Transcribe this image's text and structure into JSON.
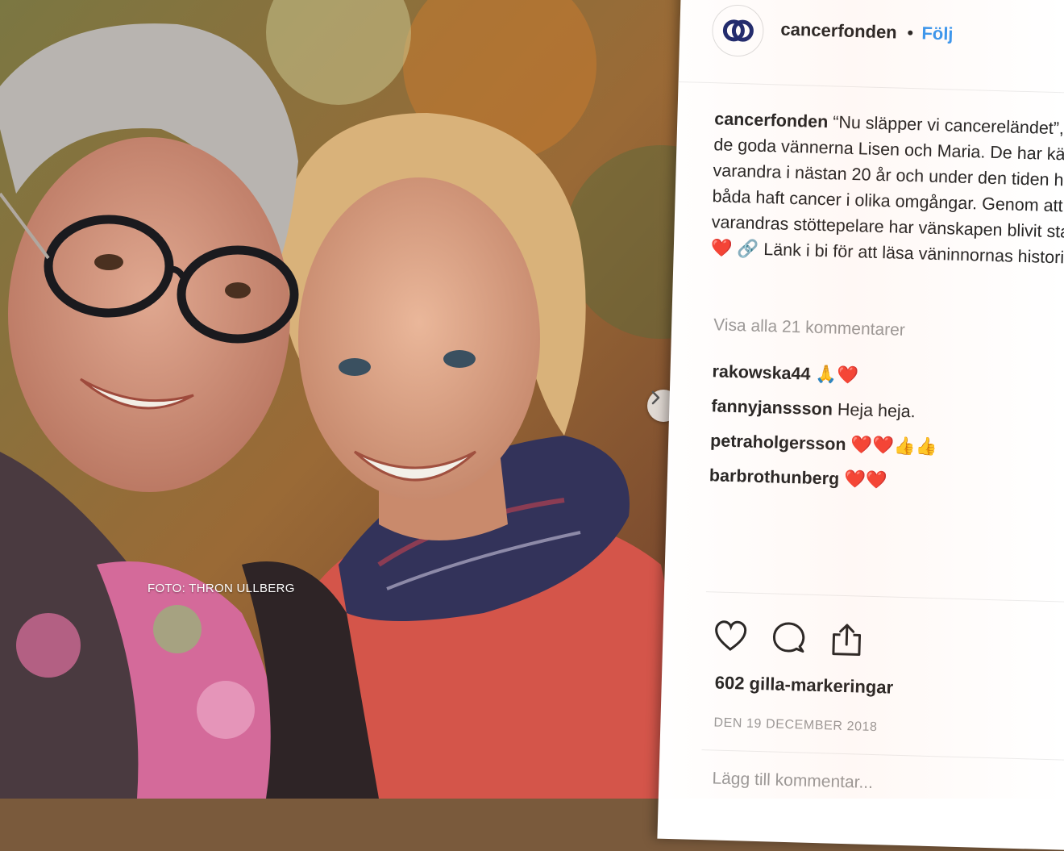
{
  "photo": {
    "credit": "FOTO: THRON ULLBERG"
  },
  "carousel": {
    "next_icon": "chevron-right-icon"
  },
  "post": {
    "header": {
      "avatar_icon": "cancerfonden-logo",
      "username": "cancerfonden",
      "separator": "•",
      "follow_label": "Följ"
    },
    "caption": {
      "username": "cancerfonden",
      "text": "“Nu släpper vi cancereländet”, säger de goda vännerna Lisen och Maria. De har känt varandra i nästan 20 år och under den tiden har de båda haft cancer i olika omgångar. Genom att vara varandras stöttepelare har vänskapen blivit starkare. ❤️ 🔗 Länk i bi för att läsa väninnornas historia."
    },
    "view_all_comments": "Visa alla 21 kommentarer",
    "comments": [
      {
        "user": "rakowska44",
        "text": "🙏❤️"
      },
      {
        "user": "fannyjanssson",
        "text": "Heja heja."
      },
      {
        "user": "petraholgersson",
        "text": "❤️❤️👍👍"
      },
      {
        "user": "barbrothunberg",
        "text": "❤️❤️"
      }
    ],
    "actions": {
      "like_icon": "heart-icon",
      "comment_icon": "comment-bubble-icon",
      "share_icon": "share-icon"
    },
    "likes": "602 gilla-markeringar",
    "date": "DEN 19 DECEMBER 2018",
    "add_comment_placeholder": "Lägg till kommentar..."
  },
  "colors": {
    "link_blue": "#3897f0",
    "text_dark": "#262626",
    "text_muted": "#999999",
    "coat_red": "#d4554a"
  }
}
